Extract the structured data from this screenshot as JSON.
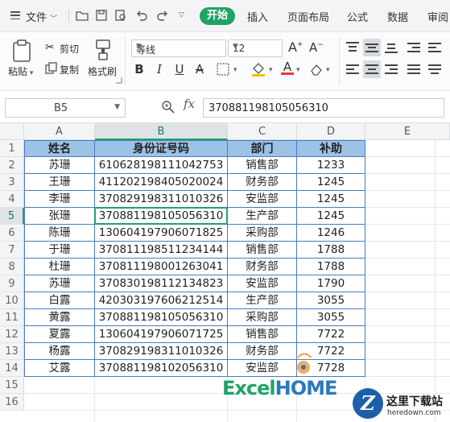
{
  "menu": {
    "file_label": "文件",
    "tabs": [
      "开始",
      "插入",
      "页面布局",
      "公式",
      "数据",
      "审阅"
    ]
  },
  "ribbon": {
    "paste": "粘贴",
    "cut": "剪切",
    "copy": "复制",
    "format_painter": "格式刷",
    "font_name": "等线",
    "font_size": "12"
  },
  "formula_bar": {
    "name_box": "B5",
    "fx": "fx",
    "value": "370881198105056310"
  },
  "sheet": {
    "columns": [
      "A",
      "B",
      "C",
      "D",
      "E"
    ],
    "rows": [
      "1",
      "2",
      "3",
      "4",
      "5",
      "6",
      "7",
      "8",
      "9",
      "10",
      "11",
      "12",
      "13",
      "14",
      "15",
      "16"
    ],
    "header": [
      "姓名",
      "身份证号码",
      "部门",
      "补助"
    ],
    "data": [
      [
        "苏珊",
        "610628198111042753",
        "销售部",
        "1233"
      ],
      [
        "王珊",
        "411202198405020024",
        "财务部",
        "1245"
      ],
      [
        "李珊",
        "370829198311010326",
        "安监部",
        "1245"
      ],
      [
        "张珊",
        "370881198105056310",
        "生产部",
        "1245"
      ],
      [
        "陈珊",
        "130604197906071825",
        "采购部",
        "1246"
      ],
      [
        "于珊",
        "370811198511234144",
        "销售部",
        "1788"
      ],
      [
        "杜珊",
        "370811198001263041",
        "财务部",
        "1788"
      ],
      [
        "苏珊",
        "370830198112134823",
        "安监部",
        "1790"
      ],
      [
        "白露",
        "420303197606212514",
        "生产部",
        "3055"
      ],
      [
        "黄露",
        "370881198105056310",
        "采购部",
        "3055"
      ],
      [
        "夏露",
        "130604197906071725",
        "销售部",
        "7722"
      ],
      [
        "杨露",
        "370829198311010326",
        "财务部",
        "7722"
      ],
      [
        "艾露",
        "370881198102056310",
        "安监部",
        "7728"
      ]
    ]
  },
  "watermark": {
    "excel": "Excel",
    "home": "HOME",
    "site_name": "这里下载站",
    "site_url": "heredown.com",
    "logo_letter": "Z"
  },
  "colors": {
    "accent": "#21a366",
    "header_fill": "#9cc3e6",
    "border": "#4a7bbf"
  }
}
